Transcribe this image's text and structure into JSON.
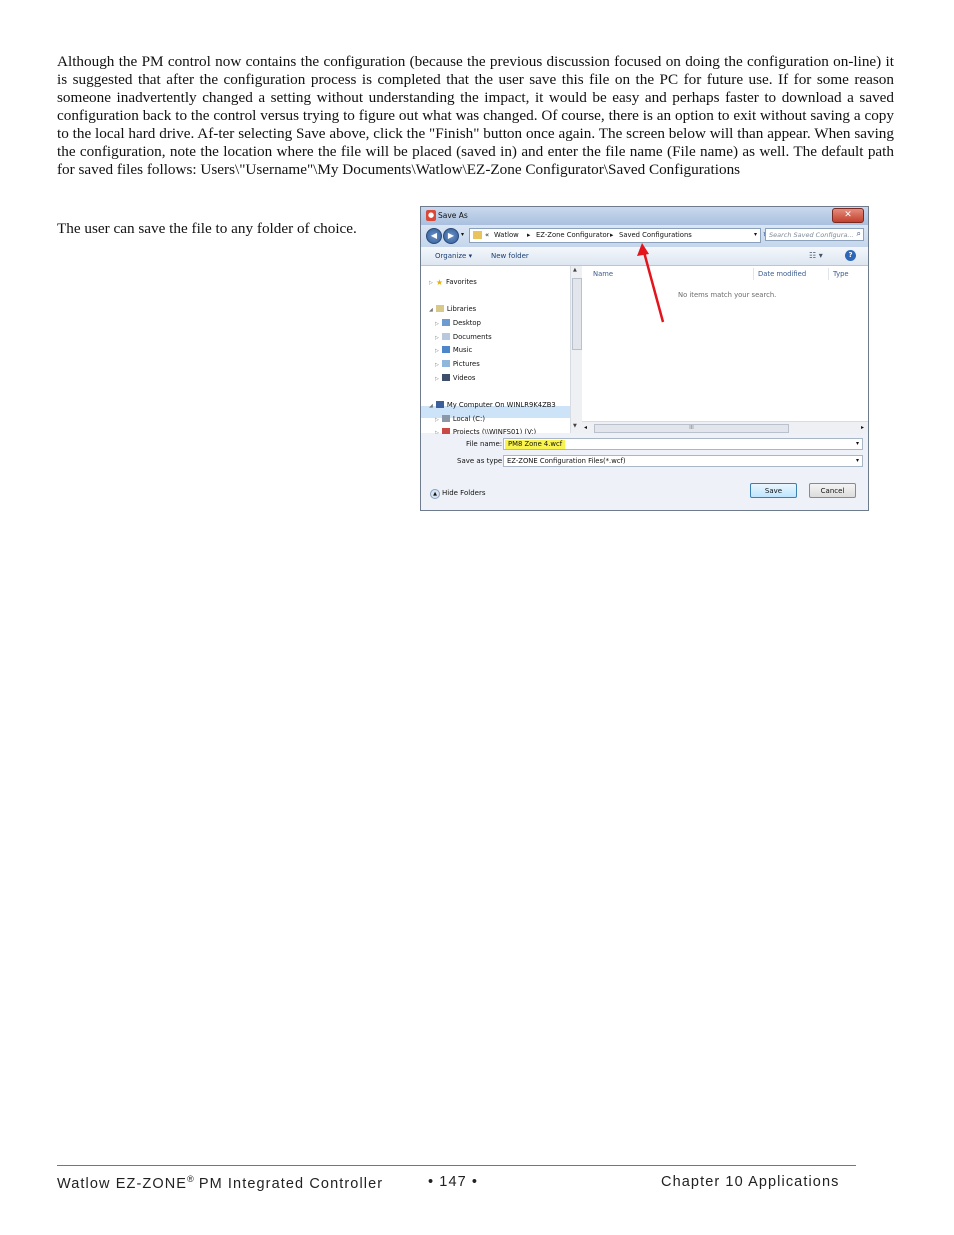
{
  "body": {
    "paragraph": "Although the PM control now contains the configuration (because the previous discussion focused on doing the configuration on-line) it is suggested that after the configuration process is completed that the user save this file on the PC for future use. If for some reason someone inadvertently changed a setting without understanding the impact, it would be easy and perhaps faster to download a saved configuration back to the control versus trying to figure out what was changed. Of course, there is an option to exit without saving a copy to the local hard drive. Af-ter selecting Save above, click the \"Finish\" button once again. The screen below will than appear. When saving the configuration, note the location where the file will be placed (saved in) and enter the file name (File name) as well. The default path for saved files follows: Users\\\"Username\"\\My Documents\\Watlow\\EZ-Zone Configurator\\Saved Configurations",
    "paragraph2": "The user can save the file to any folder of choice."
  },
  "dialog": {
    "title": "Save As",
    "close_glyph": "✕",
    "breadcrumb_prefix": "«",
    "breadcrumb": [
      "Watlow",
      "EZ-Zone Configurator",
      "Saved Configurations"
    ],
    "search_placeholder": "Search Saved Configura...",
    "toolbar": {
      "organize": "Organize ▾",
      "new_folder": "New folder",
      "help": "?"
    },
    "nav": {
      "favorites": "Favorites",
      "libraries": "Libraries",
      "library_items": [
        "Desktop",
        "Documents",
        "Music",
        "Pictures",
        "Videos"
      ],
      "computer": "My Computer On WINLR9K4ZB3",
      "drives": [
        "Local (C:)",
        "Projects (\\\\WINFS01) (V:)"
      ]
    },
    "columns": [
      "Name",
      "Date modified",
      "Type"
    ],
    "empty_message": "No items match your search.",
    "scroll_grip": "III",
    "file_name_label": "File name:",
    "file_name_value": "PM8 Zone 4.wcf",
    "save_type_label": "Save as type:",
    "save_type_value": "EZ-ZONE Configuration Files(*.wcf)",
    "hide_folders": "Hide Folders",
    "save_button": "Save",
    "cancel_button": "Cancel",
    "colors": {
      "highlight": "#f8f34e",
      "arrow": "#e3141b"
    }
  },
  "footer": {
    "left_main": "Watlow EZ-ZONE",
    "left_reg": "®",
    "left_rest": " PM Integrated Controller",
    "page": "•  147  •",
    "right": "Chapter 10 Applications"
  }
}
